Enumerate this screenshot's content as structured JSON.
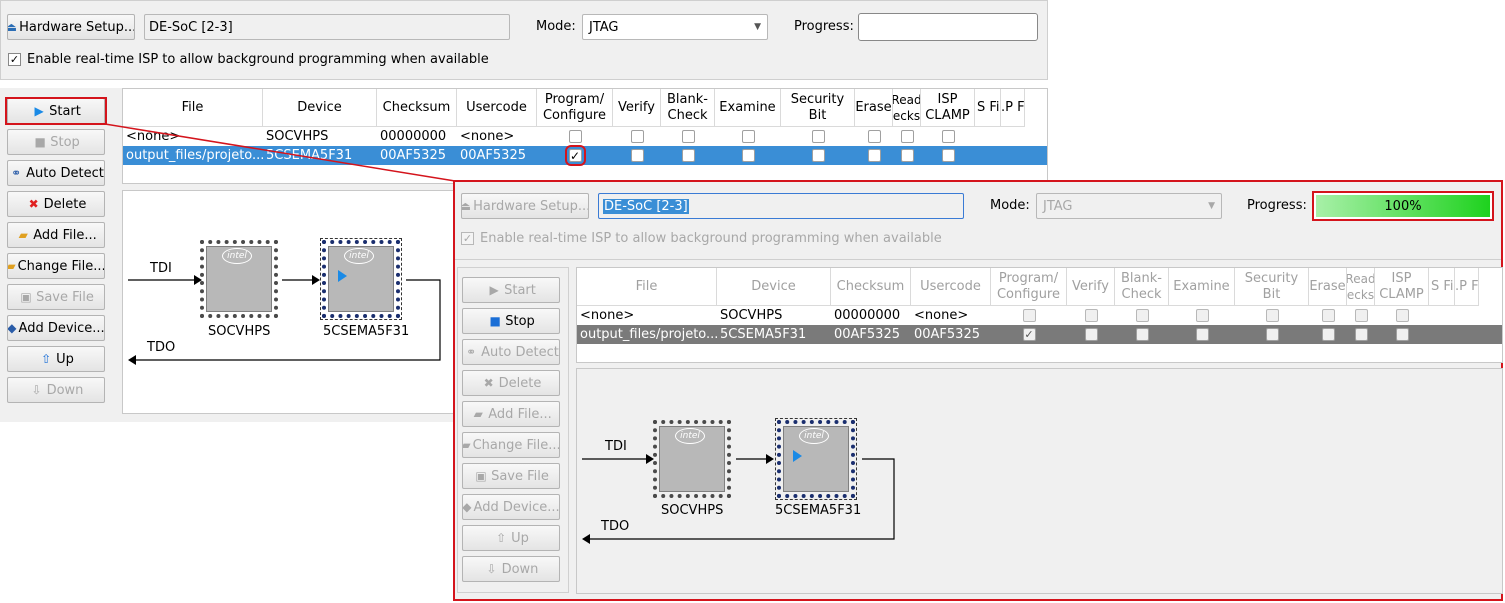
{
  "back": {
    "hardware_setup_label": "Hardware Setup...",
    "hardware_value": "DE-SoC [2-3]",
    "mode_label": "Mode:",
    "mode_value": "JTAG",
    "progress_label": "Progress:",
    "progress_value": "",
    "isp_label": "Enable real-time ISP to allow background programming when available",
    "buttons": {
      "start": "Start",
      "stop": "Stop",
      "auto_detect": "Auto Detect",
      "delete": "Delete",
      "add_file": "Add File...",
      "change_file": "Change File...",
      "save_file": "Save File",
      "add_device": "Add Device...",
      "up": "Up",
      "down": "Down"
    },
    "columns": {
      "file": "File",
      "device": "Device",
      "checksum": "Checksum",
      "usercode": "Usercode",
      "program_1": "Program/",
      "program_2": "Configure",
      "verify": "Verify",
      "blank_1": "Blank-",
      "blank_2": "Check",
      "examine": "Examine",
      "security_1": "Security",
      "security_2": "Bit",
      "erase": "Erase",
      "read_1": "Read",
      "read_2": "ecks",
      "isp_1": "ISP",
      "isp_2": "CLAMP",
      "sfi": "S Fi",
      "pf": ".P F"
    },
    "rows": [
      {
        "file": "<none>",
        "device": "SOCVHPS",
        "checksum": "00000000",
        "usercode": "<none>",
        "program": false
      },
      {
        "file": "output_files/projeto...",
        "device": "5CSEMA5F31",
        "checksum": "00AF5325",
        "usercode": "00AF5325",
        "program": true
      }
    ],
    "chain": {
      "tdi": "TDI",
      "tdo": "TDO",
      "chip1": "SOCVHPS",
      "chip2": "5CSEMA5F31",
      "logo": "intel"
    }
  },
  "front": {
    "hardware_setup_label": "Hardware Setup...",
    "hardware_value": "DE-SoC [2-3]",
    "mode_label": "Mode:",
    "mode_value": "JTAG",
    "progress_label": "Progress:",
    "progress_value": "100%",
    "progress_fraction": 1.0,
    "isp_label": "Enable real-time ISP to allow background programming when available",
    "buttons": {
      "start": "Start",
      "stop": "Stop",
      "auto_detect": "Auto Detect",
      "delete": "Delete",
      "add_file": "Add File...",
      "change_file": "Change File...",
      "save_file": "Save File",
      "add_device": "Add Device...",
      "up": "Up",
      "down": "Down"
    },
    "columns": {
      "file": "File",
      "device": "Device",
      "checksum": "Checksum",
      "usercode": "Usercode",
      "program_1": "Program/",
      "program_2": "Configure",
      "verify": "Verify",
      "blank_1": "Blank-",
      "blank_2": "Check",
      "examine": "Examine",
      "security_1": "Security",
      "security_2": "Bit",
      "erase": "Erase",
      "read_1": "Read",
      "read_2": "ecks",
      "isp_1": "ISP",
      "isp_2": "CLAMP",
      "sfi": "S Fi",
      "pf": ".P F"
    },
    "rows": [
      {
        "file": "<none>",
        "device": "SOCVHPS",
        "checksum": "00000000",
        "usercode": "<none>",
        "program": false
      },
      {
        "file": "output_files/projeto...",
        "device": "5CSEMA5F31",
        "checksum": "00AF5325",
        "usercode": "00AF5325",
        "program": true
      }
    ],
    "chain": {
      "tdi": "TDI",
      "tdo": "TDO",
      "chip1": "SOCVHPS",
      "chip2": "5CSEMA5F31",
      "logo": "intel"
    }
  },
  "colors": {
    "highlight_red": "#d4141c",
    "selection_blue": "#3a8ed6",
    "selection_gray": "#7a7a7a",
    "progress_green": "#1ed21e"
  }
}
